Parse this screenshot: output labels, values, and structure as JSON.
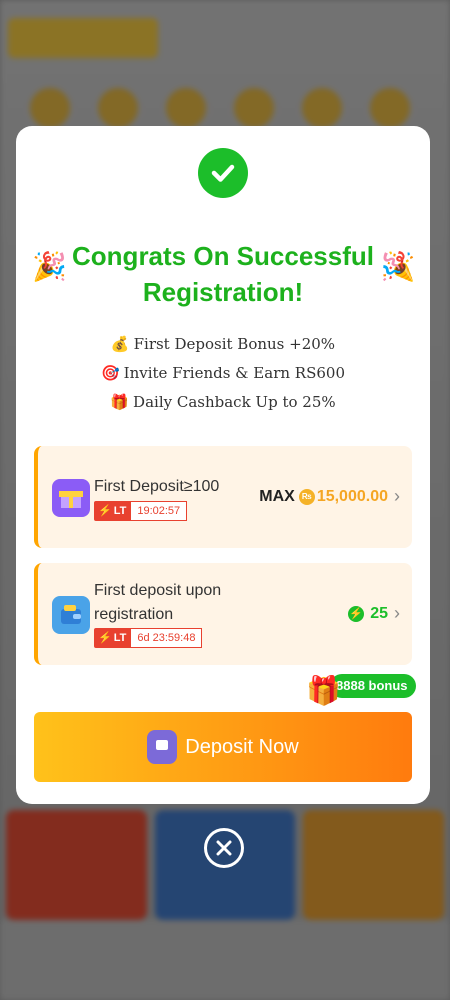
{
  "modal": {
    "title": "Congrats On Successful Registration!",
    "perks": [
      {
        "icon": "money-bag-icon",
        "emoji": "💰",
        "text": "First Deposit Bonus +20%"
      },
      {
        "icon": "target-icon",
        "emoji": "🎯",
        "text": "Invite Friends & Earn RS600"
      },
      {
        "icon": "gift-icon",
        "emoji": "🎁",
        "text": "Daily Cashback Up to 25%"
      }
    ],
    "offers": [
      {
        "title": "First Deposit≥100",
        "badge": "LT",
        "timer": "19:02:57",
        "max_label": "MAX",
        "currency_symbol": "₨",
        "amount": "15,000.00"
      },
      {
        "title": "First deposit upon registration",
        "badge": "LT",
        "timer": "6d 23:59:48",
        "bonus_count": "25"
      }
    ],
    "bonus_badge": "8888 bonus",
    "deposit_button": "Deposit Now"
  },
  "colors": {
    "success_green": "#1cbe2a",
    "accent_orange": "#ffa500",
    "timer_red": "#e8412f"
  }
}
